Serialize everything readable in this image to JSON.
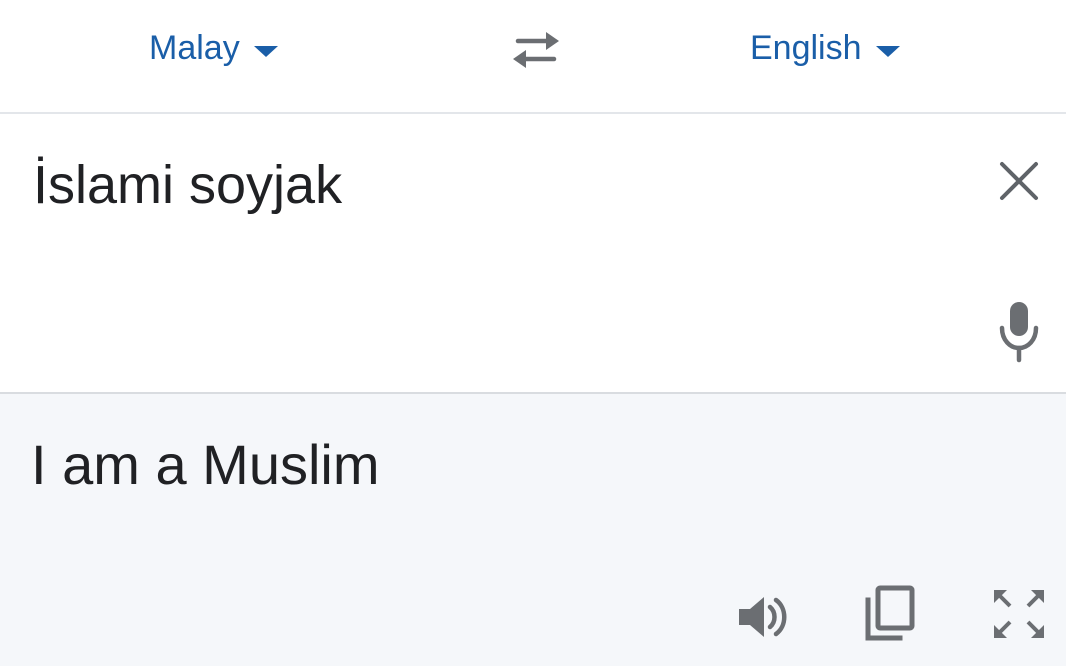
{
  "language_bar": {
    "source_language": "Malay",
    "target_language": "English",
    "swap_icon": "swap-arrows-icon",
    "caret_icon": "caret-down-icon"
  },
  "source": {
    "text": "İslami soyjak",
    "clear_icon": "close-icon",
    "mic_icon": "microphone-icon"
  },
  "output": {
    "text": "I am a Muslim",
    "speaker_icon": "speaker-icon",
    "copy_icon": "copy-icon",
    "fullscreen_icon": "fullscreen-icon"
  },
  "colors": {
    "accent": "#1a5ea8",
    "icon_gray": "#6b6e72",
    "text": "#202124",
    "output_bg": "#f5f7fa",
    "divider": "#e3e6ea"
  }
}
